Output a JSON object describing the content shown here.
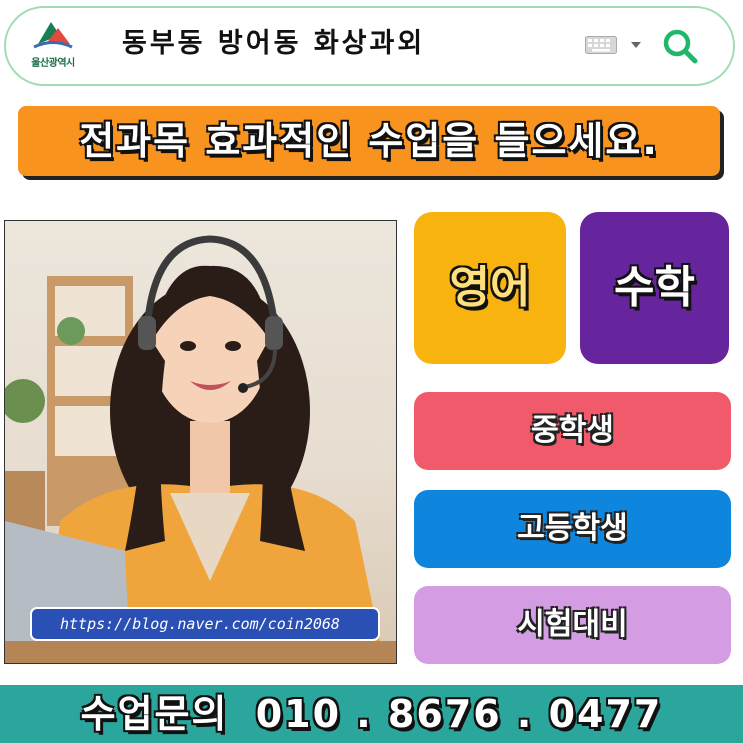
{
  "search": {
    "logo_caption": "울산광역시",
    "query": "동부동 방어동 화상과외",
    "icons": [
      "city-emblem-icon",
      "keyboard-icon",
      "chevron-down-icon",
      "search-icon"
    ],
    "accent_color": "#1fb86b"
  },
  "banner": {
    "text": "전과목 효과적인 수업을 들으세요.",
    "color": "#f7931e"
  },
  "photo": {
    "url_label": "https://blog.naver.com/coin2068"
  },
  "subjects": [
    {
      "label": "영어",
      "color": "#f8b30f"
    },
    {
      "label": "수학",
      "color": "#66249d"
    }
  ],
  "levels": [
    {
      "label": "중학생",
      "color": "#f05a6b"
    },
    {
      "label": "고등학생",
      "color": "#0f86dd"
    },
    {
      "label": "시험대비",
      "color": "#d39ce3"
    }
  ],
  "footer": {
    "label": "수업문의",
    "phone": "010 . 8676 . 0477",
    "color": "#2aa69c"
  }
}
